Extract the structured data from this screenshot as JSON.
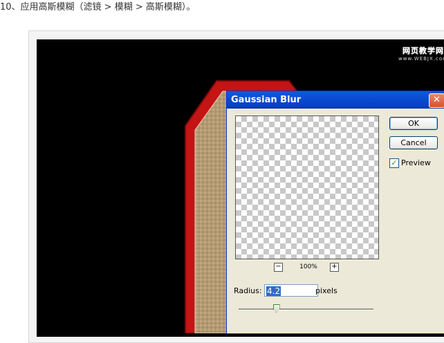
{
  "caption": "10、应用高斯模糊（滤镜 > 模糊 > 高斯模糊）。",
  "watermark": {
    "title": "网页教学网",
    "url": "www.WEBJX.com"
  },
  "dialog": {
    "title": "Gaussian Blur",
    "close_glyph": "✕",
    "ok_label": "OK",
    "cancel_label": "Cancel",
    "preview_label": "Preview",
    "preview_checked": true,
    "check_glyph": "✓",
    "zoom_out_glyph": "−",
    "zoom_in_glyph": "+",
    "zoom_level": "100%",
    "radius_label": "Radius:",
    "radius_value": "4.2",
    "units_label": "pixels",
    "slider_level_fraction": 0.28
  },
  "colors": {
    "titlebar": "#0b4bd2",
    "dialog_bg": "#ece9d8",
    "tag_red": "#c41414",
    "tag_burlap": "#b49a73",
    "canvas": "#000000"
  }
}
